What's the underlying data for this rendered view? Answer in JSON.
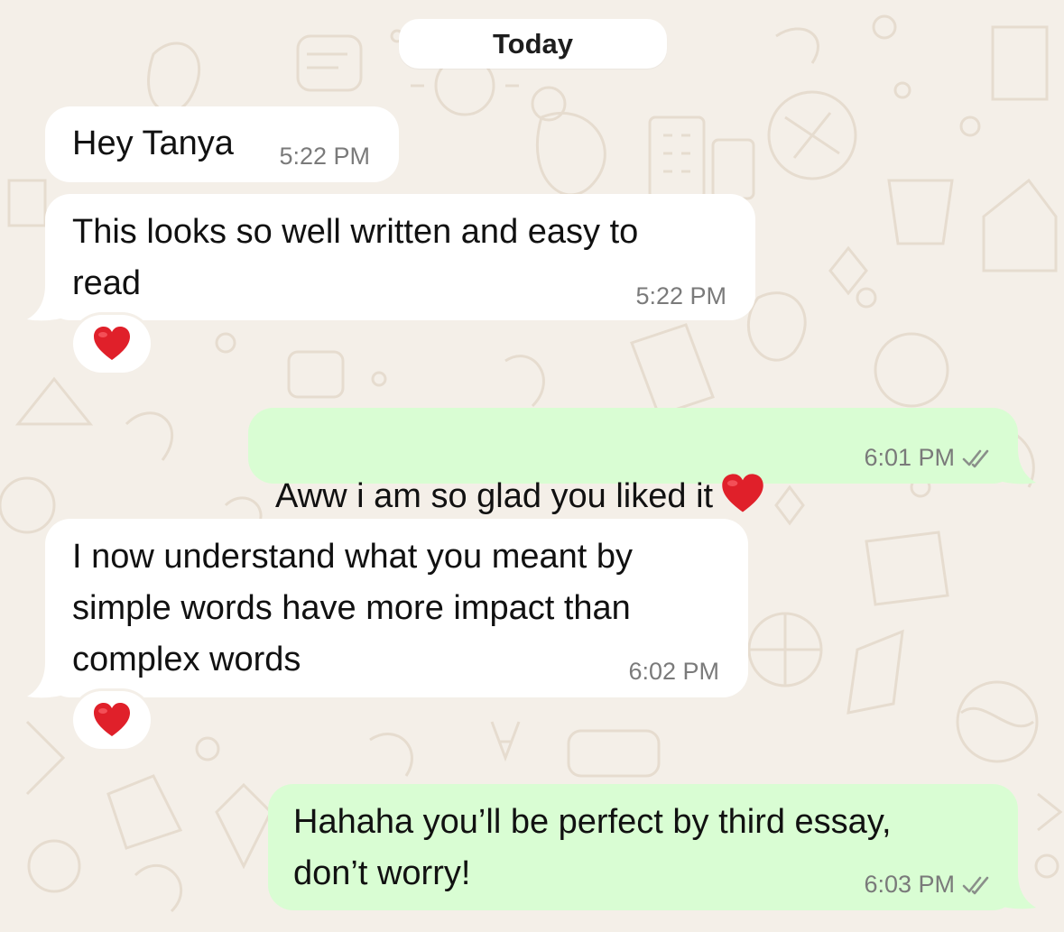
{
  "chat": {
    "date_label": "Today",
    "messages": [
      {
        "direction": "incoming",
        "text": "Hey Tanya",
        "time": "5:22 PM"
      },
      {
        "direction": "incoming",
        "text": "This looks so well written and easy to\nread",
        "time": "5:22 PM",
        "reaction": "red-heart"
      },
      {
        "direction": "outgoing",
        "text": "Aww i am so glad you liked it",
        "emoji": "red-heart",
        "time": "6:01 PM",
        "status": "read-double-check"
      },
      {
        "direction": "incoming",
        "text": "I now understand what you meant by\nsimple words have more impact than\ncomplex words",
        "time": "6:02 PM",
        "reaction": "red-heart"
      },
      {
        "direction": "outgoing",
        "text": "Hahaha you’ll be perfect by third essay,\ndon’t worry!",
        "time": "6:03 PM",
        "status": "read-double-check"
      }
    ]
  },
  "colors": {
    "wallpaper": "#f4efe8",
    "incoming_bubble": "#ffffff",
    "outgoing_bubble": "#d9fdd3",
    "timestamp": "#7a7a7a",
    "heart": "#e0202a"
  }
}
